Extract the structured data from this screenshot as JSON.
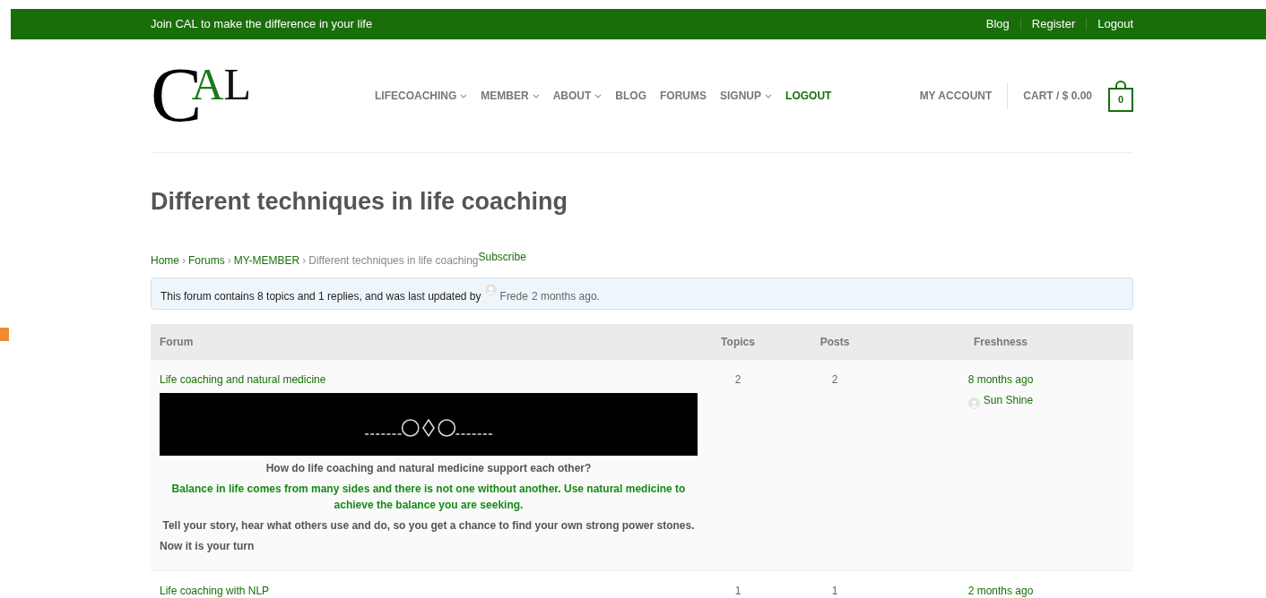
{
  "top_bar": {
    "tagline": "Join CAL to make the difference in your life",
    "links": [
      "Blog",
      "Register",
      "Logout"
    ]
  },
  "logo": {
    "parts": [
      {
        "text": "C",
        "kind": "big"
      },
      {
        "text": "A",
        "kind": "accent"
      },
      {
        "text": "L",
        "kind": "plain"
      }
    ]
  },
  "nav": [
    {
      "label": "LIFECOACHING",
      "has_menu": true,
      "selected": false
    },
    {
      "label": "MEMBER",
      "has_menu": true,
      "selected": false
    },
    {
      "label": "ABOUT",
      "has_menu": true,
      "selected": false
    },
    {
      "label": "BLOG",
      "has_menu": false,
      "selected": false
    },
    {
      "label": "FORUMS",
      "has_menu": false,
      "selected": false
    },
    {
      "label": "SIGNUP",
      "has_menu": true,
      "selected": false
    },
    {
      "label": "LOGOUT",
      "has_menu": false,
      "selected": true
    }
  ],
  "account": {
    "my_account": "MY ACCOUNT",
    "cart": "CART / $ 0.00",
    "cart_count": "0"
  },
  "page_title": "Different techniques in life coaching",
  "breadcrumb": {
    "separator": "›",
    "links": [
      "Home",
      "Forums",
      "MY-MEMBER"
    ],
    "current": "Different techniques in life coaching",
    "subscribe": "Subscribe"
  },
  "notice": {
    "text": "This forum contains 8 topics and 1 replies, and was last updated by",
    "user": "Frede",
    "time": "2 months ago."
  },
  "table": {
    "columns": [
      "Forum",
      "Topics",
      "Posts",
      "Freshness"
    ],
    "rows": [
      {
        "title": "Life coaching and natural medicine",
        "paragraphs": [
          {
            "kind": "question",
            "text": "How do life coaching and natural medicine support each other?"
          },
          {
            "kind": "highlight",
            "text": "Balance in life comes from many sides and there is not one without another. Use natural medicine to achieve the balance you are seeking."
          },
          {
            "kind": "plain",
            "text": "Tell your story, hear what others use and do, so you get a chance to find your own strong power stones."
          },
          {
            "kind": "closing",
            "text": "Now it is your turn"
          }
        ],
        "topics": "2",
        "posts": "2",
        "freshness": "8 months ago",
        "author": "Sun Shine"
      },
      {
        "title": "Life coaching with NLP",
        "paragraphs": [],
        "topics": "1",
        "posts": "1",
        "freshness": "2 months ago"
      }
    ]
  }
}
